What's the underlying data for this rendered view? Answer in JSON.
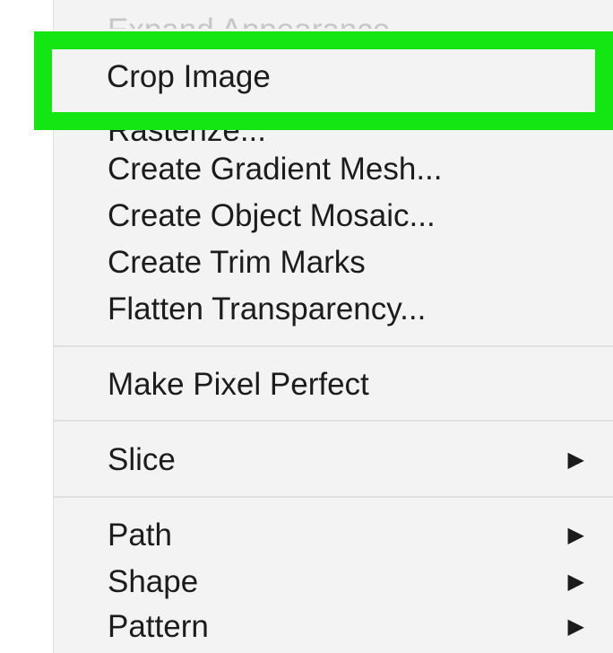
{
  "menu": {
    "faded_top_item": "Expand Appearance",
    "highlighted_item": "Crop Image",
    "partially_hidden_item": "Rasterize...",
    "items_group_1": [
      {
        "label": "Create Gradient Mesh..."
      },
      {
        "label": "Create Object Mosaic..."
      },
      {
        "label": "Create Trim Marks"
      },
      {
        "label": "Flatten Transparency..."
      }
    ],
    "items_group_2": [
      {
        "label": "Make Pixel Perfect"
      }
    ],
    "items_group_3": [
      {
        "label": "Slice",
        "submenu_arrow": "▶"
      }
    ],
    "items_group_4": [
      {
        "label": "Path",
        "submenu_arrow": "▶"
      },
      {
        "label": "Shape",
        "submenu_arrow": "▶"
      },
      {
        "label": "Pattern",
        "submenu_arrow": "▶"
      }
    ]
  },
  "colors": {
    "highlight_border": "#14e614",
    "menu_background": "#f3f3f3",
    "text": "#1c1c1c",
    "faded_text": "#c7c7c7"
  }
}
